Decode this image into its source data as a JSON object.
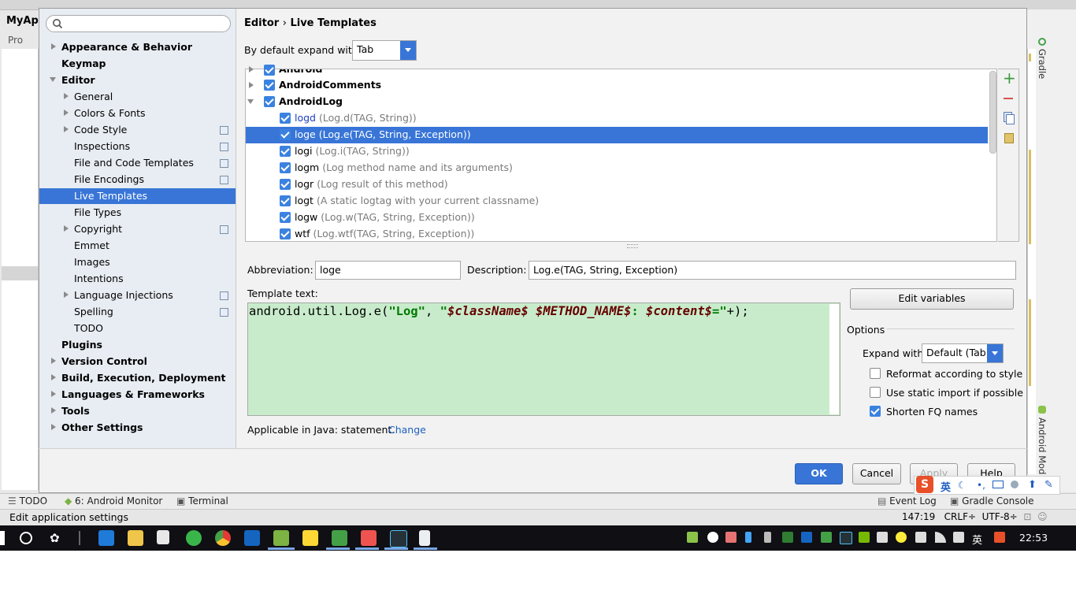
{
  "ide": {
    "project_title": "MyApp",
    "project_tab": "Pro",
    "right_tabs": {
      "gradle": "Gradle",
      "android_model": "Android Mod"
    },
    "bottom_tools": [
      {
        "label": "TODO"
      },
      {
        "label": "6: Android Monitor"
      },
      {
        "label": "Terminal"
      },
      {
        "label": "Event Log"
      },
      {
        "label": "Gradle Console"
      }
    ],
    "status": {
      "text": "Edit application settings",
      "position": "147:19",
      "line_sep": "CRLF÷",
      "encoding": "UTF-8÷"
    }
  },
  "sidebar": {
    "search_placeholder": "",
    "items": [
      {
        "label": "Appearance & Behavior",
        "bold": true,
        "arrow": "right"
      },
      {
        "label": "Keymap",
        "bold": true,
        "arrow": ""
      },
      {
        "label": "Editor",
        "bold": true,
        "arrow": "down"
      },
      {
        "label": "General",
        "arrow": "right"
      },
      {
        "label": "Colors & Fonts",
        "arrow": "right"
      },
      {
        "label": "Code Style",
        "arrow": "right",
        "proj": true
      },
      {
        "label": "Inspections",
        "arrow": "",
        "proj": true
      },
      {
        "label": "File and Code Templates",
        "arrow": "",
        "proj": true
      },
      {
        "label": "File Encodings",
        "arrow": "",
        "proj": true
      },
      {
        "label": "Live Templates",
        "arrow": "",
        "selected": true
      },
      {
        "label": "File Types",
        "arrow": ""
      },
      {
        "label": "Copyright",
        "arrow": "right",
        "proj": true
      },
      {
        "label": "Emmet",
        "arrow": ""
      },
      {
        "label": "Images",
        "arrow": ""
      },
      {
        "label": "Intentions",
        "arrow": ""
      },
      {
        "label": "Language Injections",
        "arrow": "right",
        "proj": true
      },
      {
        "label": "Spelling",
        "arrow": "",
        "proj": true
      },
      {
        "label": "TODO",
        "arrow": ""
      },
      {
        "label": "Plugins",
        "bold": true,
        "arrow": ""
      },
      {
        "label": "Version Control",
        "bold": true,
        "arrow": "right"
      },
      {
        "label": "Build, Execution, Deployment",
        "bold": true,
        "arrow": "right"
      },
      {
        "label": "Languages & Frameworks",
        "bold": true,
        "arrow": "right"
      },
      {
        "label": "Tools",
        "bold": true,
        "arrow": "right"
      },
      {
        "label": "Other Settings",
        "bold": true,
        "arrow": "right"
      }
    ]
  },
  "content": {
    "breadcrumb_editor": "Editor",
    "breadcrumb_sep": "›",
    "breadcrumb_page": "Live Templates",
    "expand_label": "By default expand with",
    "expand_value": "Tab",
    "groups": [
      {
        "name": "Android",
        "expanded": false
      },
      {
        "name": "AndroidComments",
        "expanded": false
      },
      {
        "name": "AndroidLog",
        "expanded": true
      }
    ],
    "templates": [
      {
        "abbr": "logd",
        "desc": "(Log.d(TAG, String))",
        "modified": true
      },
      {
        "abbr": "loge",
        "desc": "(Log.e(TAG, String, Exception))",
        "selected": true
      },
      {
        "abbr": "logi",
        "desc": "(Log.i(TAG, String))"
      },
      {
        "abbr": "logm",
        "desc": "(Log method name and its arguments)"
      },
      {
        "abbr": "logr",
        "desc": "(Log result of this method)"
      },
      {
        "abbr": "logt",
        "desc": "(A static logtag with your current classname)"
      },
      {
        "abbr": "logw",
        "desc": "(Log.w(TAG, String, Exception))"
      },
      {
        "abbr": "wtf",
        "desc": "(Log.wtf(TAG, String, Exception))"
      }
    ],
    "abbreviation_label": "Abbreviation:",
    "abbreviation_value": "loge",
    "description_label": "Description:",
    "description_value": "Log.e(TAG, String, Exception)",
    "template_text_label": "Template text:",
    "template_code": {
      "p1": "android.util.Log.e(",
      "s1": "\"Log\"",
      "p2": ", ",
      "s2": "\"",
      "v1": "$className$",
      "sp1": " ",
      "v2": "$METHOD_NAME$",
      "s3": ": ",
      "v3": "$content$",
      "s4": "=\"",
      "p3": "+);"
    },
    "applicable_label": "Applicable in Java: statement.",
    "change_link": "Change",
    "edit_variables": "Edit variables",
    "options_label": "Options",
    "expand_with_label": "Expand with",
    "expand_with_value": "Default (Tab)",
    "options": [
      {
        "label": "Reformat according to style",
        "checked": false
      },
      {
        "label": "Use static import if possible",
        "checked": false
      },
      {
        "label": "Shorten FQ names",
        "checked": true
      }
    ]
  },
  "buttons": {
    "ok": "OK",
    "cancel": "Cancel",
    "apply": "Apply",
    "help": "Help"
  },
  "ime": {
    "lang": "英"
  },
  "taskbar": {
    "clock": "22:53",
    "tray_lang": "英"
  },
  "colors": {
    "accent": "#3875d7",
    "template_bg": "#c8eccb",
    "taskbar": "#0f0f14"
  }
}
